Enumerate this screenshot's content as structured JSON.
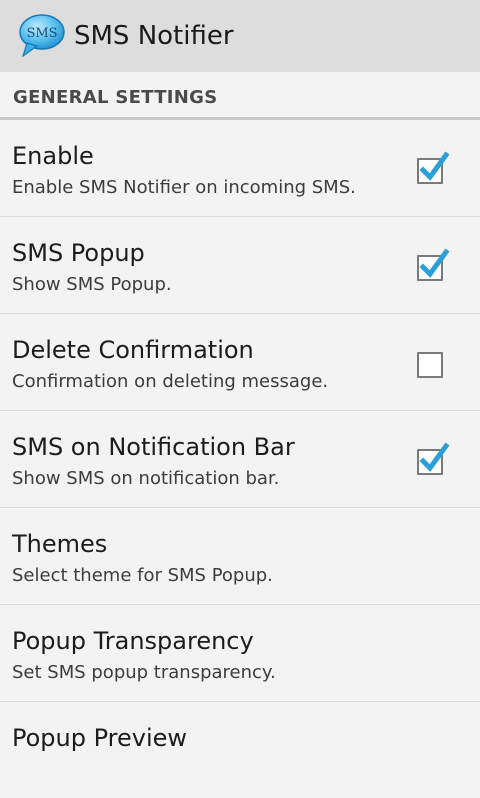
{
  "action_bar": {
    "title": "SMS Notifier",
    "icon_text": "SMS",
    "icon": "sms-bubble-icon"
  },
  "section": {
    "title": "GENERAL SETTINGS"
  },
  "preferences": [
    {
      "title": "Enable",
      "summary": "Enable SMS Notifier on incoming SMS.",
      "checkbox": true,
      "checked": true
    },
    {
      "title": "SMS Popup",
      "summary": "Show SMS Popup.",
      "checkbox": true,
      "checked": true
    },
    {
      "title": "Delete Confirmation",
      "summary": "Confirmation on deleting message.",
      "checkbox": true,
      "checked": false
    },
    {
      "title": "SMS on Notification Bar",
      "summary": "Show SMS on notification bar.",
      "checkbox": true,
      "checked": true
    },
    {
      "title": "Themes",
      "summary": "Select theme for SMS Popup.",
      "checkbox": false
    },
    {
      "title": "Popup Transparency",
      "summary": "Set SMS popup transparency.",
      "checkbox": false
    },
    {
      "title": "Popup Preview",
      "summary": "",
      "checkbox": false
    }
  ],
  "colors": {
    "accent": "#2b9fd8",
    "action_bar_bg": "#dddddd",
    "background": "#f3f3f3"
  }
}
